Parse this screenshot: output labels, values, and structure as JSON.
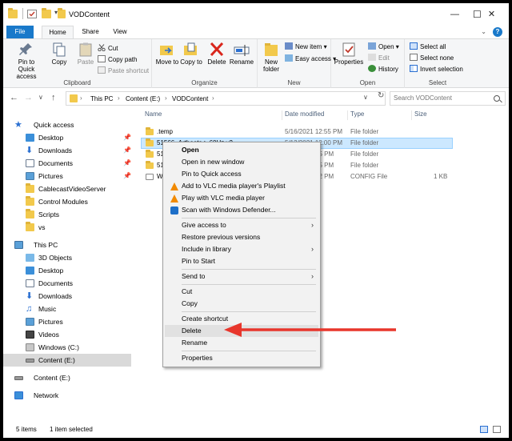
{
  "window": {
    "title": "VODContent",
    "minimize": "—",
    "maximize": "☐",
    "close": "✕"
  },
  "tabs": {
    "file": "File",
    "home": "Home",
    "share": "Share",
    "view": "View"
  },
  "ribbon": {
    "clipboard": {
      "label": "Clipboard",
      "pin": "Pin to Quick access",
      "copy": "Copy",
      "paste": "Paste",
      "cut": "Cut",
      "copy_path": "Copy path",
      "paste_shortcut": "Paste shortcut"
    },
    "organize": {
      "label": "Organize",
      "move_to": "Move to",
      "copy_to": "Copy to",
      "delete": "Delete",
      "rename": "Rename"
    },
    "new": {
      "label": "New",
      "new_folder": "New folder",
      "new_item": "New item ▾",
      "easy_access": "Easy access ▾"
    },
    "open": {
      "label": "Open",
      "properties": "Properties",
      "open": "Open ▾",
      "edit": "Edit",
      "history": "History"
    },
    "select": {
      "label": "Select",
      "select_all": "Select all",
      "select_none": "Select none",
      "invert": "Invert selection"
    }
  },
  "address": {
    "crumbs": [
      "This PC",
      "Content (E:)",
      "VODContent"
    ],
    "search_placeholder": "Search VODContent"
  },
  "nav": {
    "quick_access": "Quick access",
    "desktop": "Desktop",
    "downloads": "Downloads",
    "documents": "Documents",
    "pictures": "Pictures",
    "cablecast": "CablecastVideoServer",
    "control_modules": "Control Modules",
    "scripts": "Scripts",
    "vs": "vs",
    "this_pc": "This PC",
    "objects3d": "3D Objects",
    "desktop2": "Desktop",
    "documents2": "Documents",
    "downloads2": "Downloads",
    "music": "Music",
    "pictures2": "Pictures",
    "videos": "Videos",
    "windows_c": "Windows (C:)",
    "content_e": "Content (E:)",
    "content_e2": "Content (E:)",
    "network": "Network"
  },
  "columns": {
    "name": "Name",
    "date": "Date modified",
    "type": "Type",
    "size": "Size"
  },
  "rows": [
    {
      "name": ".temp",
      "date": "5/16/2021 12:55 PM",
      "type": "File folder",
      "size": ""
    },
    {
      "name": "51566_Arthoats > 60Hz v2",
      "date": "5/12/2021 12:00 PM",
      "type": "File folder",
      "size": ""
    },
    {
      "name": "515",
      "date": "55 PM",
      "type": "File folder",
      "size": ""
    },
    {
      "name": "516",
      "date": "15 PM",
      "type": "File folder",
      "size": ""
    },
    {
      "name": "We",
      "date": "42 PM",
      "type": "CONFIG File",
      "size": "1 KB"
    }
  ],
  "status": {
    "items": "5 items",
    "selected": "1 item selected"
  },
  "context_menu": {
    "open": "Open",
    "open_new_window": "Open in new window",
    "pin_quick": "Pin to Quick access",
    "vlc_add": "Add to VLC media player's Playlist",
    "vlc_play": "Play with VLC media player",
    "defender": "Scan with Windows Defender...",
    "give_access": "Give access to",
    "restore": "Restore previous versions",
    "include_library": "Include in library",
    "pin_start": "Pin to Start",
    "send_to": "Send to",
    "cut": "Cut",
    "copy": "Copy",
    "create_shortcut": "Create shortcut",
    "delete": "Delete",
    "rename": "Rename",
    "properties": "Properties"
  },
  "colors": {
    "accent": "#1979ca",
    "folder": "#f2c94c",
    "selection": "#cce8ff",
    "arrow": "#e8362c"
  }
}
